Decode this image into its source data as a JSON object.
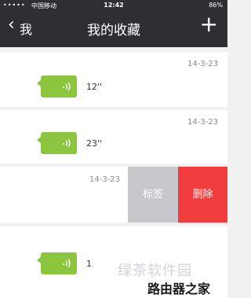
{
  "status_bar": {
    "signal_dots": "•••••",
    "carrier": "中国移动",
    "time": "12:42",
    "battery": "86%"
  },
  "nav": {
    "back_chevron": "‹",
    "back_label": "我",
    "title": "我的收藏",
    "add": "+"
  },
  "items": [
    {
      "date": "14-3-23",
      "duration": "12''"
    },
    {
      "date": "14-3-23",
      "duration": "23''"
    },
    {
      "date": "14-3-23",
      "actions": {
        "tag": "标签",
        "delete": "删除"
      }
    },
    {
      "date": "",
      "duration": "1"
    }
  ],
  "watermark": {
    "line1": "绿茶软件园",
    "line2": "路由器之家"
  },
  "colors": {
    "nav_bg": "#2d2f33",
    "voice_bubble": "#8cc63e",
    "tag_button": "#c7c7cc",
    "delete_button": "#f03c3c"
  },
  "icons": [
    "wifi-icon",
    "lock-icon",
    "voice-wave-icon",
    "plus-icon"
  ]
}
